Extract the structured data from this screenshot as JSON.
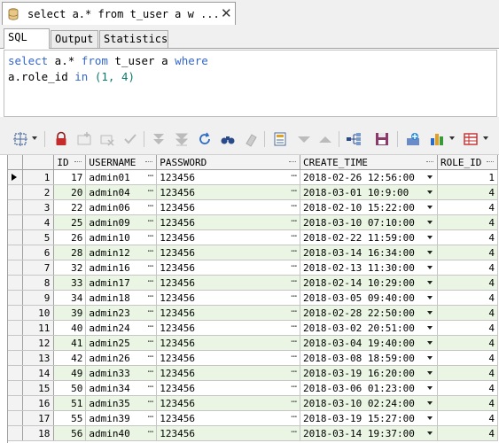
{
  "document_tab": {
    "title": "select a.* from t_user a w ...",
    "close_symbol": "✕"
  },
  "subtabs": [
    {
      "label": "SQL",
      "active": true
    },
    {
      "label": "Output",
      "active": false
    },
    {
      "label": "Statistics",
      "active": false
    }
  ],
  "editor": {
    "line1": {
      "kw1": "select",
      "t1": " a.* ",
      "kw2": "from",
      "t2": " t_user a ",
      "kw3": "where"
    },
    "line2": {
      "t1": "a.role_id ",
      "kw1": "in",
      "t2": " ",
      "num": "(1, 4)"
    }
  },
  "toolbar": {
    "icons": [
      "grid-options-icon",
      "lock-icon",
      "insert-record-icon",
      "delete-record-icon",
      "post-edit-icon",
      "first-icon",
      "last-icon",
      "refresh-icon",
      "find-icon",
      "clear-icon",
      "query-by-example-icon",
      "filter-icon",
      "sort-icon",
      "tree-icon",
      "save-icon",
      "chart-data-icon",
      "bar-chart-icon",
      "export-icon"
    ]
  },
  "grid": {
    "columns": [
      "ID",
      "USERNAME",
      "PASSWORD",
      "CREATE_TIME",
      "ROLE_ID"
    ],
    "rows": [
      [
        "1",
        "17",
        "admin01",
        "123456",
        "2018-02-26 12:56:00",
        "1"
      ],
      [
        "2",
        "20",
        "admin04",
        "123456",
        "2018-03-01 10:9:00",
        "4"
      ],
      [
        "3",
        "22",
        "admin06",
        "123456",
        "2018-02-10 15:22:00",
        "4"
      ],
      [
        "4",
        "25",
        "admin09",
        "123456",
        "2018-03-10 07:10:00",
        "4"
      ],
      [
        "5",
        "26",
        "admin10",
        "123456",
        "2018-02-22 11:59:00",
        "4"
      ],
      [
        "6",
        "28",
        "admin12",
        "123456",
        "2018-03-14 16:34:00",
        "4"
      ],
      [
        "7",
        "32",
        "admin16",
        "123456",
        "2018-02-13 11:30:00",
        "4"
      ],
      [
        "8",
        "33",
        "admin17",
        "123456",
        "2018-02-14 10:29:00",
        "4"
      ],
      [
        "9",
        "34",
        "admin18",
        "123456",
        "2018-03-05 09:40:00",
        "4"
      ],
      [
        "10",
        "39",
        "admin23",
        "123456",
        "2018-02-28 22:50:00",
        "4"
      ],
      [
        "11",
        "40",
        "admin24",
        "123456",
        "2018-03-02 20:51:00",
        "4"
      ],
      [
        "12",
        "41",
        "admin25",
        "123456",
        "2018-03-04 19:40:00",
        "4"
      ],
      [
        "13",
        "42",
        "admin26",
        "123456",
        "2018-03-08 18:59:00",
        "4"
      ],
      [
        "14",
        "49",
        "admin33",
        "123456",
        "2018-03-19 16:20:00",
        "4"
      ],
      [
        "15",
        "50",
        "admin34",
        "123456",
        "2018-03-06 01:23:00",
        "4"
      ],
      [
        "16",
        "51",
        "admin35",
        "123456",
        "2018-03-10 02:24:00",
        "4"
      ],
      [
        "17",
        "55",
        "admin39",
        "123456",
        "2018-03-19 15:27:00",
        "4"
      ],
      [
        "18",
        "56",
        "admin40",
        "123456",
        "2018-03-14 19:37:00",
        "4"
      ]
    ]
  },
  "colors": {
    "alt_row": "#eaf5e4",
    "keyword": "#3366cc",
    "number": "#0a7a6a"
  }
}
